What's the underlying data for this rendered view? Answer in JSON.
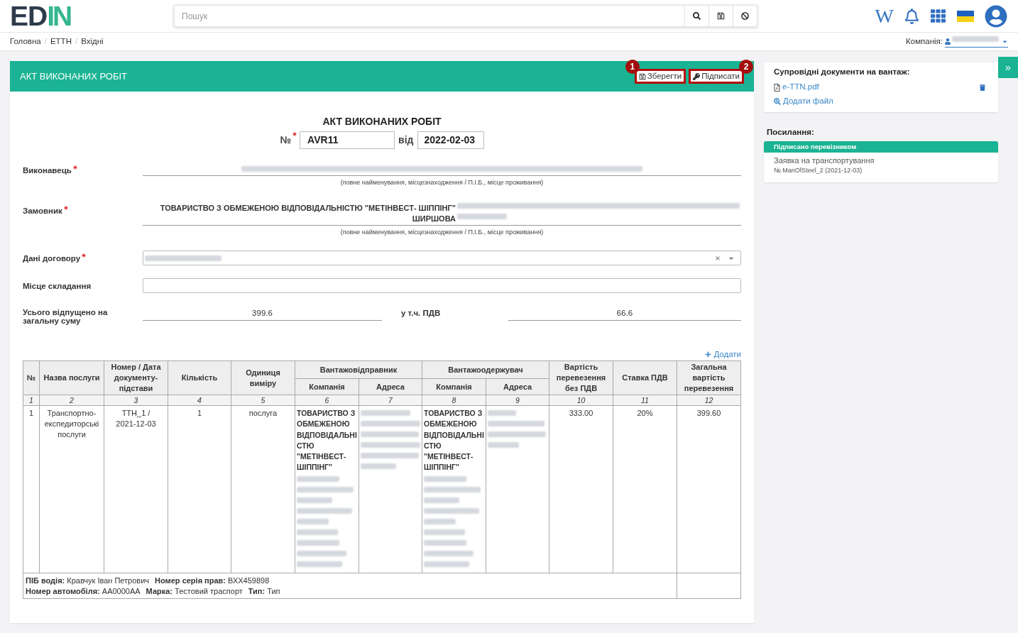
{
  "header": {
    "logo": {
      "dark": "ED",
      "accent": "IN"
    },
    "search": {
      "placeholder": "Пошук"
    },
    "wiki_glyph": "W"
  },
  "breadcrumb": {
    "items": [
      "Головна",
      "ЕТТН",
      "Вхідні"
    ],
    "separator": "/"
  },
  "company": {
    "label": "Компанія:"
  },
  "document": {
    "header_title": "АКТ ВИКОНАНИХ РОБІТ",
    "actions": [
      {
        "kind": "save",
        "label": "Зберегти",
        "callout": "1",
        "callout_right": false,
        "highlighted": true
      },
      {
        "kind": "sign",
        "label": "Підписати",
        "callout": "2",
        "callout_right": true,
        "highlighted": true
      }
    ],
    "title": "АКТ ВИКОНАНИХ РОБІТ",
    "number": {
      "label": "№",
      "required": true,
      "value": "AVR11"
    },
    "date": {
      "label": "від",
      "value": "2022-02-03"
    },
    "parties": [
      {
        "label": "Виконавець",
        "required": true,
        "caption": "(повне найменування, місцезнаходження / П.І.Б., місце проживання)"
      },
      {
        "label": "Замовник",
        "required": true,
        "value_lines": [
          "ТОВАРИСТВО З ОБМЕЖЕНОЮ ВІДПОВІДАЛЬНІСТЮ \"МЕТІНВЕСТ- ШІППІНГ\"",
          "ШИРШОВА"
        ],
        "caption": "(повне найменування, місцезнаходження / П.І.Б., місце проживання)"
      }
    ],
    "contract": {
      "label": "Дані договору",
      "required": true
    },
    "place": {
      "label": "Місце складання",
      "required": false
    },
    "totals": {
      "label": "Усього відпущено на загальну суму",
      "value": "399.6",
      "vat_label": "у т.ч. ПДВ",
      "vat_value": "66.6"
    },
    "add_row": {
      "label": "Додати"
    },
    "table": {
      "columns": [
        {
          "label": "№"
        },
        {
          "label": "Назва послуги"
        },
        {
          "label": "Номер / Дата документу-підстави"
        },
        {
          "label": "Кількість"
        },
        {
          "label": "Одиниця виміру"
        },
        {
          "label": "Вантажовідправник",
          "subcolumns": [
            "Компанія",
            "Адреса"
          ]
        },
        {
          "label": "Вантажоодержувач",
          "subcolumns": [
            "Компанія",
            "Адреса"
          ]
        },
        {
          "label": "Вартість перевезення без ПДВ"
        },
        {
          "label": "Ставка ПДВ"
        },
        {
          "label": "Загальна вартість перевезення"
        }
      ],
      "column_numbers": [
        "1",
        "2",
        "3",
        "4",
        "5",
        "6",
        "7",
        "8",
        "9",
        "10",
        "11",
        "12"
      ],
      "rows": [
        {
          "number": "1",
          "service": "Транспортно-експедиторські послуги",
          "document": "ТТН_1 / 2021-12-03",
          "quantity": "1",
          "unit": "послуга",
          "shipper_company": "ТОВАРИСТВО З ОБМЕЖЕНОЮ ВІДПОВІДАЛЬНІСТЮ \"МЕТІНВЕСТ-ШІППІНГ\"",
          "consignee_company": "ТОВАРИСТВО З ОБМЕЖЕНОЮ ВІДПОВІДАЛЬНІСТЮ \"МЕТІНВЕСТ-ШІППІНГ\"",
          "cost": "333.00",
          "vat_rate": "20%",
          "total": "399.60"
        }
      ],
      "footer_lines": [
        {
          "fields": [
            "**ПІБ водія:** Кравчук Іван Петрович",
            "**Номер серія прав:** ВХХ459898"
          ]
        },
        {
          "fields": [
            "**Номер автомобіля:** АА0000АА",
            "**Марка:** Тестовий траспорт",
            "**Тип:** Тип"
          ]
        }
      ]
    }
  },
  "sidebar": {
    "documents": {
      "title": "Супровідні документи на вантаж:",
      "files": [
        {
          "name": "e-TTN.pdf"
        }
      ],
      "add_label": "Додати файл"
    },
    "links": {
      "title": "Посилання:",
      "items": [
        {
          "status": "Підписано перевізником",
          "title": "Заявка на транспортування",
          "number": "№ ManOfSteel_2 (2021-12-03)"
        }
      ]
    }
  },
  "sidebar_toggle": "»"
}
